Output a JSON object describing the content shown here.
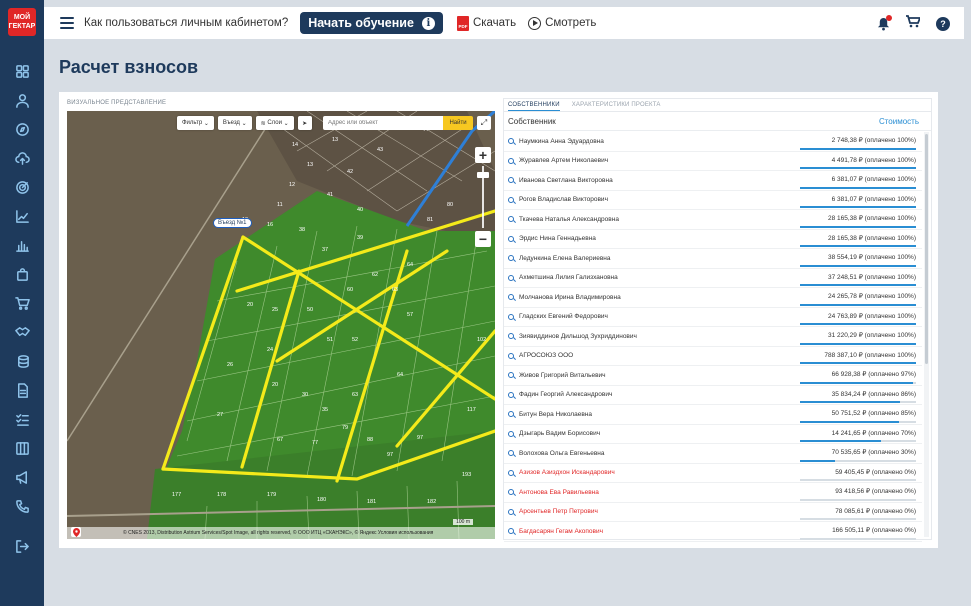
{
  "sidebar": {
    "logo_line1": "МОЙ",
    "logo_line2": "ГЕКТАР",
    "icons": [
      "grid-icon",
      "user-icon",
      "compass-icon",
      "cloud-upload-icon",
      "target-icon",
      "trending-icon",
      "bar-chart-icon",
      "bag-icon",
      "cart-icon",
      "handshake-icon",
      "coins-icon",
      "document-icon",
      "checklist-icon",
      "book-icon",
      "megaphone-icon",
      "phone-icon",
      "logout-icon"
    ]
  },
  "topbar": {
    "how_to": "Как пользоваться личным кабинетом?",
    "start_label": "Начать обучение",
    "info_glyph": "i",
    "pdf_badge": "PDF",
    "download_label": "Скачать",
    "watch_label": "Смотреть",
    "help_glyph": "?"
  },
  "page": {
    "title": "Расчет взносов"
  },
  "map": {
    "section_label": "ВИЗУАЛЬНОЕ ПРЕДСТАВЛЕНИЕ",
    "filter_label": "Фильтр",
    "entry_dropdown_label": "Въезд",
    "layers_label": "Слои",
    "search_placeholder": "Адрес или объект",
    "find_label": "Найти",
    "zoom_in": "+",
    "zoom_out": "−",
    "entry_marker": "Въезд №1",
    "scale_label": "100 m",
    "footer": "© CNES 2013, Distribution Astrium Services/Spot Image, all rights reserved, © ООО ИТЦ «СКАНЭКС», © Яндекс Условия использования"
  },
  "owners_panel": {
    "tabs": [
      {
        "label": "СОБСТВЕННИКИ",
        "active": true
      },
      {
        "label": "ХАРАКТЕРИСТИКИ ПРОЕКТА",
        "active": false
      }
    ],
    "col_owner": "Собственник",
    "col_cost": "Стоимость",
    "rows": [
      {
        "name": "Наумкина Анна Эдуардовна",
        "amount": "2 748,38 ₽ (оплачено 100%)",
        "paid": 1.0
      },
      {
        "name": "Журавлев Артем Николаевич",
        "amount": "4 491,78 ₽ (оплачено 100%)",
        "paid": 1.0
      },
      {
        "name": "Иванова Светлана Викторовна",
        "amount": "6 381,07 ₽ (оплачено 100%)",
        "paid": 1.0
      },
      {
        "name": "Рогов Владислав Викторович",
        "amount": "6 381,07 ₽ (оплачено 100%)",
        "paid": 1.0
      },
      {
        "name": "Ткачева Наталья Александровна",
        "amount": "28 165,38 ₽ (оплачено 100%)",
        "paid": 1.0
      },
      {
        "name": "Эрдис Нина Геннадьевна",
        "amount": "28 165,38 ₽ (оплачено 100%)",
        "paid": 1.0
      },
      {
        "name": "Ледункина Елена Валериевна",
        "amount": "38 554,19 ₽ (оплачено 100%)",
        "paid": 1.0
      },
      {
        "name": "Ахметшина Лилия Гализхановна",
        "amount": "37 248,51 ₽ (оплачено 100%)",
        "paid": 1.0
      },
      {
        "name": "Молчанова Ирина Владимировна",
        "amount": "24 265,78 ₽ (оплачено 100%)",
        "paid": 1.0
      },
      {
        "name": "Гладских Евгений Федорович",
        "amount": "24 763,89 ₽ (оплачено 100%)",
        "paid": 1.0
      },
      {
        "name": "Зиявиддинов Дильшод Зухриддинович",
        "amount": "31 220,29 ₽ (оплачено 100%)",
        "paid": 1.0
      },
      {
        "name": "АГРОСОЮЗ ООО",
        "amount": "788 387,10 ₽ (оплачено 100%)",
        "paid": 1.0
      },
      {
        "name": "Живов Григорий Витальевич",
        "amount": "66 928,38 ₽ (оплачено 97%)",
        "paid": 0.97
      },
      {
        "name": "Фадин Георгий Александрович",
        "amount": "35 834,24 ₽ (оплачено 86%)",
        "paid": 0.86
      },
      {
        "name": "Битун Вера Николаевна",
        "amount": "50 751,52 ₽ (оплачено 85%)",
        "paid": 0.85
      },
      {
        "name": "Дзыгарь Вадим Борисович",
        "amount": "14 241,65 ₽ (оплачено 70%)",
        "paid": 0.7
      },
      {
        "name": "Волохова Ольга Евгеньевна",
        "amount": "70 535,65 ₽ (оплачено 30%)",
        "paid": 0.3
      },
      {
        "name": "Азизов Азиздхон Искандарович",
        "amount": "59 405,45 ₽ (оплачено 0%)",
        "paid": 0
      },
      {
        "name": "Антонова Ева Равильевна",
        "amount": "93 418,56 ₽ (оплачено 0%)",
        "paid": 0
      },
      {
        "name": "Арсентьев Петр Петрович",
        "amount": "78 085,61 ₽ (оплачено 0%)",
        "paid": 0
      },
      {
        "name": "Багдасарян Гегам Акопович",
        "amount": "166 505,11 ₽ (оплачено 0%)",
        "paid": 0
      }
    ]
  },
  "colors": {
    "sidebar": "#1e3a5c",
    "accent_blue": "#2a8ed3",
    "unpaid_red": "#e02727",
    "field_green": "#3f8a2c",
    "road_yellow": "#f4ea1a"
  }
}
